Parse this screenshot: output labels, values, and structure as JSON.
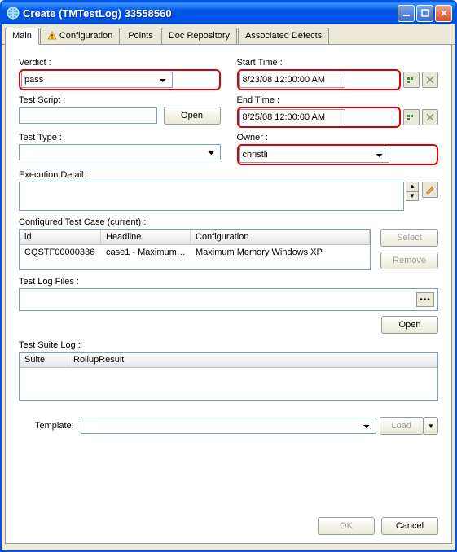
{
  "title": "Create (TMTestLog) 33558560",
  "tabs": [
    "Main",
    "Configuration",
    "Points",
    "Doc Repository",
    "Associated Defects"
  ],
  "activeTab": "Main",
  "labels": {
    "verdict": "Verdict :",
    "startTime": "Start Time :",
    "testScript": "Test Script :",
    "endTime": "End Time :",
    "testType": "Test Type :",
    "owner": "Owner :",
    "execDetail": "Execution Detail :",
    "configTC": "Configured Test Case (current) :",
    "testLogFiles": "Test Log Files :",
    "testSuiteLog": "Test Suite Log :",
    "template": "Template:"
  },
  "values": {
    "verdict": "pass",
    "startTime": "8/23/08 12:00:00 AM",
    "endTime": "8/25/08 12:00:00 AM",
    "owner": "christli",
    "testScript": "",
    "testType": "",
    "template": ""
  },
  "buttons": {
    "open": "Open",
    "select": "Select",
    "remove": "Remove",
    "open2": "Open",
    "load": "Load",
    "ok": "OK",
    "cancel": "Cancel"
  },
  "tableHeaders": {
    "id": "id",
    "headline": "Headline",
    "configuration": "Configuration"
  },
  "tableRow": {
    "id": "CQSTF00000336",
    "headline": "case1 - Maximum ...",
    "configuration": "Maximum Memory Windows XP"
  },
  "suiteHeaders": {
    "suite": "Suite",
    "rollup": "RollupResult"
  }
}
